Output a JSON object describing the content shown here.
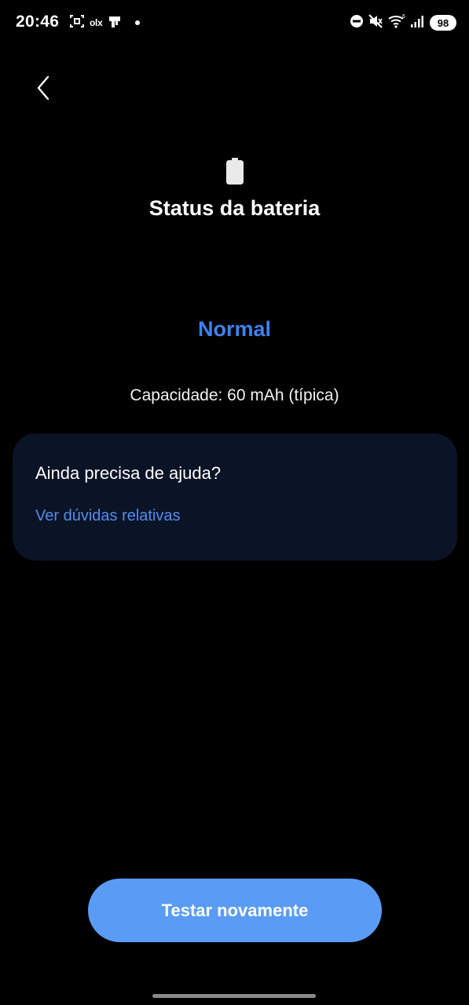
{
  "status_bar": {
    "time": "20:46",
    "olx_label": "olx",
    "battery_level": "98",
    "left_icons": [
      "screenshot-icon",
      "olx-icon",
      "shopping-bag-icon",
      "dot-icon"
    ],
    "right_icons": [
      "do-not-disturb-icon",
      "mute-icon",
      "wifi-icon",
      "signal-icon",
      "battery-icon"
    ]
  },
  "header": {
    "back_icon": "chevron-left-icon",
    "icon": "battery-icon",
    "title": "Status da bateria"
  },
  "battery": {
    "status": "Normal",
    "capacity": "Capacidade: 60 mAh (típica)"
  },
  "help_card": {
    "title": "Ainda precisa de ajuda?",
    "link": "Ver dúvidas relativas"
  },
  "actions": {
    "retest_label": "Testar novamente"
  },
  "colors": {
    "background": "#000000",
    "accent": "#3e82ee",
    "link": "#4f8ef2",
    "card_background": "#0b1326",
    "button_background": "#5a9cf5"
  }
}
